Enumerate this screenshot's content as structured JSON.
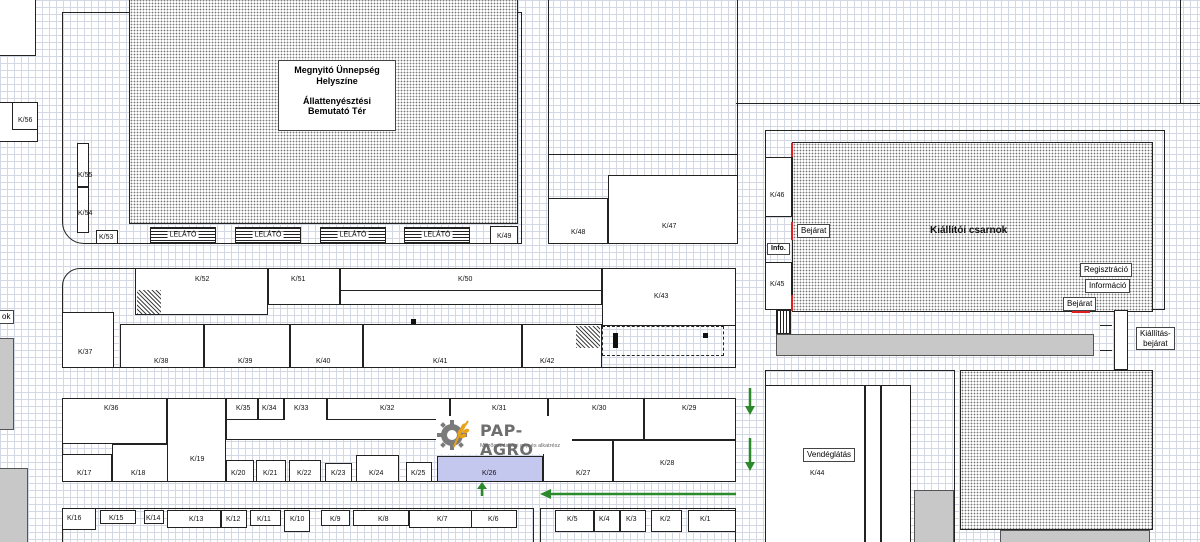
{
  "title_box": {
    "line1": "Megnyitó Ünnepség",
    "line2": "Helyszíne",
    "line3": "Állattenyésztési",
    "line4": "Bemutató Tér"
  },
  "grandstand_label": "LELÁTÓ",
  "hall_label": "Kiállítói csarnok",
  "entrance_label": "Bejárat",
  "info_label": "Info.",
  "registration_label": "Regisztráció",
  "information_label": "Információ",
  "exhibition_entrance_line1": "Kiállítás-",
  "exhibition_entrance_line2": "bejárat",
  "catering_label": "Vendéglátás",
  "left_edge_label": "ok",
  "logo": {
    "name": "PAP-AGRO",
    "tagline": "Mezőgazdasági gép és alkatrész"
  },
  "stands": {
    "K1": "K/1",
    "K2": "K/2",
    "K3": "K/3",
    "K4": "K/4",
    "K5": "K/5",
    "K6": "K/6",
    "K7": "K/7",
    "K8": "K/8",
    "K9": "K/9",
    "K10": "K/10",
    "K11": "K/11",
    "K12": "K/12",
    "K13": "K/13",
    "K14": "K/14",
    "K15": "K/15",
    "K16": "K/16",
    "K17": "K/17",
    "K18": "K/18",
    "K19": "K/19",
    "K20": "K/20",
    "K21": "K/21",
    "K22": "K/22",
    "K23": "K/23",
    "K24": "K/24",
    "K25": "K/25",
    "K26": "K/26",
    "K27": "K/27",
    "K28": "K/28",
    "K29": "K/29",
    "K30": "K/30",
    "K31": "K/31",
    "K32": "K/32",
    "K33": "K/33",
    "K34": "K/34",
    "K35": "K/35",
    "K36": "K/36",
    "K37": "K/37",
    "K38": "K/38",
    "K39": "K/39",
    "K40": "K/40",
    "K41": "K/41",
    "K42": "K/42",
    "K43": "K/43",
    "K44": "K/44",
    "K45": "K/45",
    "K46": "K/46",
    "K47": "K/47",
    "K48": "K/48",
    "K49": "K/49",
    "K50": "K/50",
    "K51": "K/51",
    "K52": "K/52",
    "K53": "K/53",
    "K54": "K/54",
    "K55": "K/55",
    "K56": "K/56"
  },
  "colors": {
    "highlight_stand": "#c5c8ee",
    "arrow": "#2c8a2c",
    "entrance_marker": "#e02020",
    "grid": "#d4d8e4"
  }
}
